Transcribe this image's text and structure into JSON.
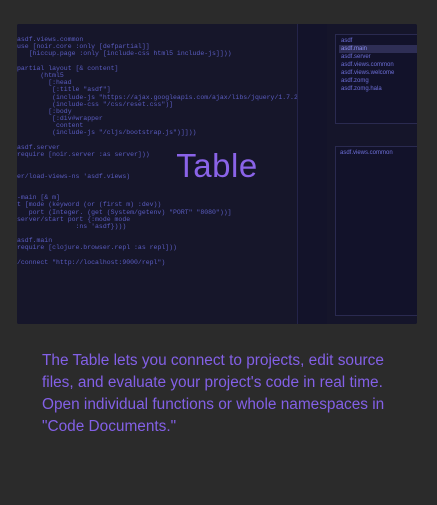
{
  "screenshot": {
    "title": "Table",
    "editor": {
      "lines": [
        "asdf.views.common",
        "use [noir.core :only [defpartial]]",
        "   [hiccup.page :only [include-css html5 include-js]]))",
        "",
        "partial layout [& content]",
        "      (html5",
        "        [:head",
        "         [:title \"asdf\"]",
        "         (include-js \"https://ajax.googleapis.com/ajax/libs/jquery/1.7.2/jq",
        "         (include-css \"/css/reset.css\")]",
        "        [:body",
        "         [:div#wrapper",
        "          content",
        "         (include-js \"/cljs/bootstrap.js\")]]))",
        "",
        "asdf.server",
        "require [noir.server :as server]))",
        "",
        "",
        "er/load-views-ns 'asdf.views)",
        "",
        "",
        "-main [& m]",
        "t [mode (keyword (or (first m) :dev))",
        "   port (Integer. (get (System/getenv) \"PORT\" \"8080\"))]",
        "server/start port {:mode mode",
        "               :ns 'asdf})))",
        "",
        "asdf.main",
        "require [clojure.browser.repl :as repl]))",
        "",
        "/connect \"http://localhost:9000/repl\")"
      ]
    },
    "namespaces": {
      "items": [
        "asdf",
        "asdf.main",
        "asdf.server",
        "asdf.views.common",
        "asdf.views.welcome",
        "asdf.zomg",
        "asdf.zomg.hala"
      ],
      "active_index": 1
    },
    "document": {
      "label": "asdf.views.common"
    }
  },
  "description": "The Table lets you connect to projects, edit source files, and evaluate your project's code in real time. Open individual functions or whole namespaces in \"Code Documents.\"",
  "colors": {
    "accent": "#8a63e8",
    "code": "#5a5cc0",
    "background": "#2b2b2b"
  }
}
